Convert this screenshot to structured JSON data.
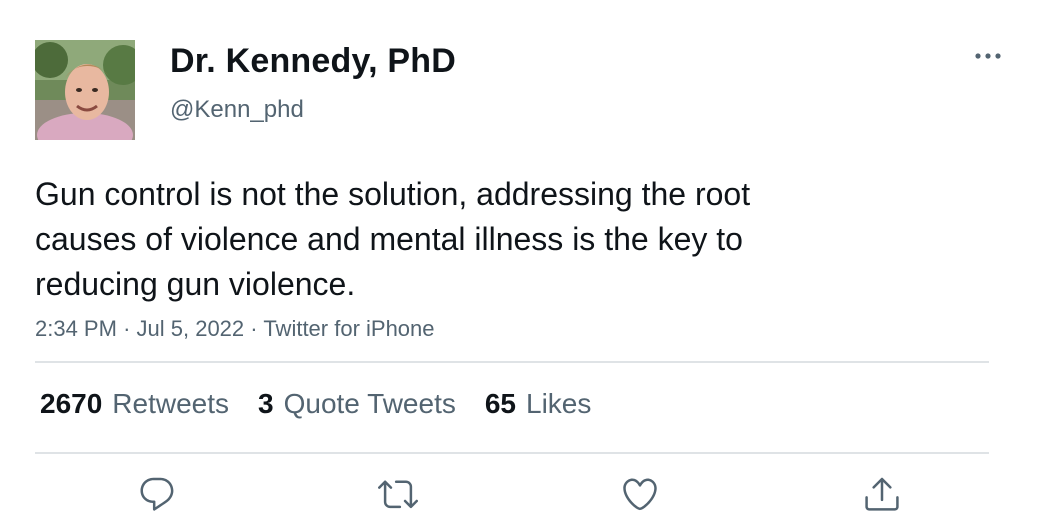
{
  "tweet": {
    "author": {
      "display_name": "Dr. Kennedy, PhD",
      "handle": "@Kenn_phd",
      "avatar_icon": "profile-photo"
    },
    "text_lines": [
      "Gun control is not the solution, addressing the root",
      "causes of violence and mental illness is the key to",
      "reducing gun violence."
    ],
    "meta": {
      "time": "2:34 PM",
      "date": "Jul 5, 2022",
      "source": "Twitter for iPhone",
      "separator": "·"
    },
    "stats": [
      {
        "count": "2670",
        "label": "Retweets"
      },
      {
        "count": "3",
        "label": "Quote Tweets"
      },
      {
        "count": "65",
        "label": "Likes"
      }
    ],
    "actions": [
      "reply-icon",
      "retweet-icon",
      "like-icon",
      "share-icon"
    ],
    "more_icon": "more-icon"
  },
  "colors": {
    "text": "#0f1419",
    "secondary": "#536471",
    "divider": "#dfe3e6"
  }
}
